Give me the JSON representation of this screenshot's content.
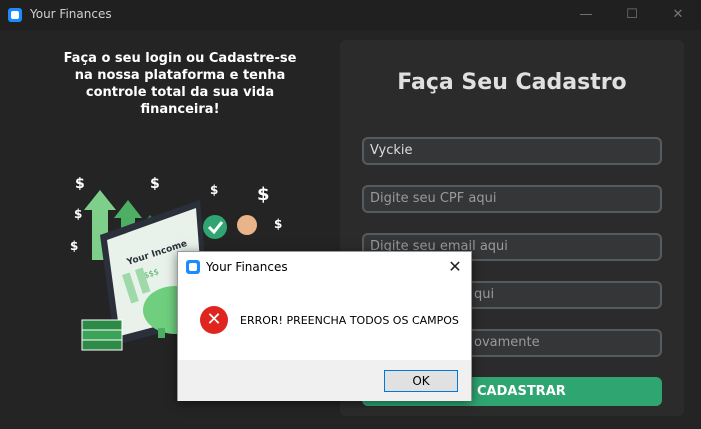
{
  "window": {
    "title": "Your Finances",
    "min_glyph": "—",
    "max_glyph": "☐",
    "close_glyph": "✕"
  },
  "promo": {
    "line1": "Faça o seu login ou Cadastre-se",
    "line2": "na nossa plataforma e tenha",
    "line3": "controle total da sua vida financeira!"
  },
  "illustration": {
    "laptop_title": "Your Income",
    "laptop_amount": "$$$$",
    "dollar_glyph": "$"
  },
  "form": {
    "title": "Faça Seu Cadastro",
    "name_value": "Vyckie",
    "cpf_placeholder": "Digite seu CPF aqui",
    "email_placeholder": "Digite seu email aqui",
    "field4_visible_text": "qui",
    "field5_visible_text": "ovamente",
    "submit_label": "CADASTRAR"
  },
  "dialog": {
    "title": "Your Finances",
    "message": "ERROR! PREENCHA TODOS OS CAMPOS",
    "ok_label": "OK",
    "close_glyph": "✕",
    "error_glyph": "✕"
  },
  "colors": {
    "accent_green": "#2fa572",
    "error_red": "#e0241e",
    "app_blue": "#1a8cff"
  }
}
